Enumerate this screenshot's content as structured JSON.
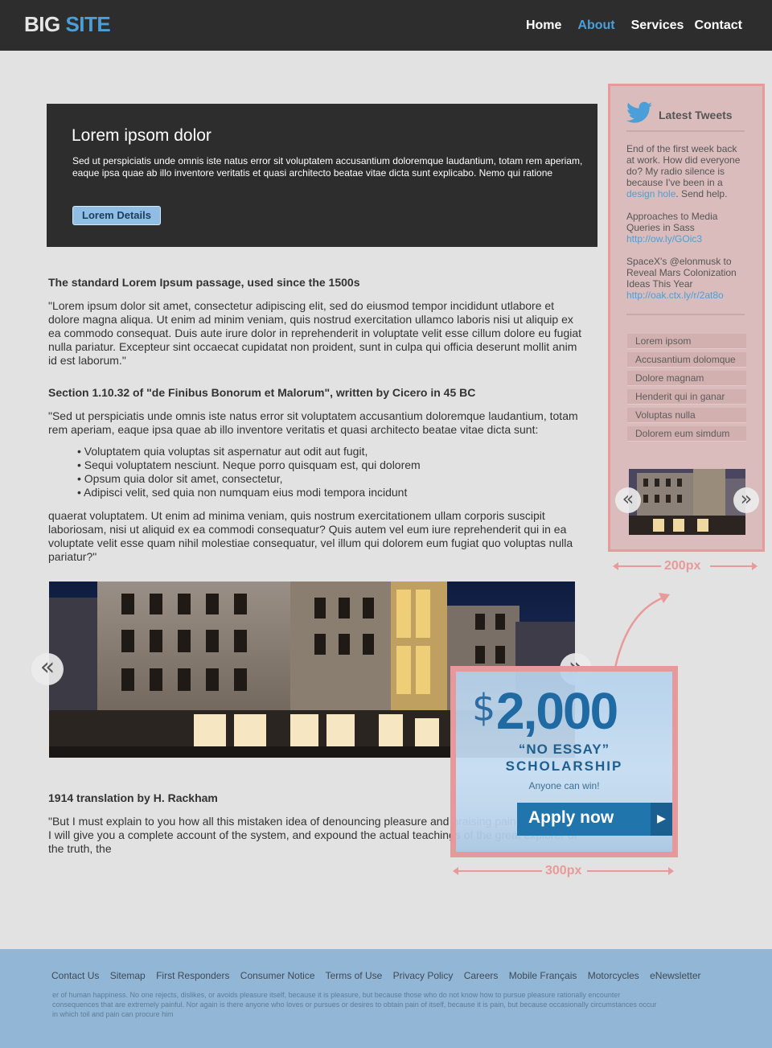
{
  "header": {
    "logo_big": "BIG",
    "logo_site": "SITE",
    "nav": [
      "Home",
      "About",
      "Services",
      "Contact"
    ],
    "active_nav": "About"
  },
  "hero": {
    "title": "Lorem ipsom dolor",
    "text": "Sed ut perspiciatis unde omnis iste natus error sit voluptatem accusantium doloremque laudantium, totam rem aperiam, eaque ipsa quae ab illo inventore veritatis et quasi architecto beatae vitae dicta sunt explicabo. Nemo qui ratione",
    "button": "Lorem Details"
  },
  "content": {
    "section1_title": "The standard Lorem Ipsum passage, used since the 1500s",
    "section1_text": "\"Lorem ipsum dolor sit amet, consectetur adipiscing elit, sed do eiusmod tempor incididunt utlabore et dolore magna aliqua. Ut enim ad minim veniam, quis nostrud exercitation ullamco laboris nisi ut aliquip ex ea commodo consequat. Duis aute irure dolor in reprehenderit in voluptate velit esse cillum dolore eu fugiat nulla pariatur. Excepteur sint occaecat cupidatat non proident, sunt in culpa qui officia deserunt mollit anim id est laborum.\"",
    "section2_title": "Section 1.10.32 of \"de Finibus Bonorum et Malorum\", written by Cicero in 45 BC",
    "section2_text": "\"Sed ut perspiciatis unde omnis iste natus error sit voluptatem accusantium doloremque laudantium, totam rem aperiam, eaque ipsa quae ab illo inventore veritatis et quasi architecto beatae vitae dicta sunt:",
    "bullets": [
      "Voluptatem quia voluptas sit aspernatur aut odit aut fugit,",
      "Sequi voluptatem nesciunt. Neque porro quisquam est, qui dolorem",
      "Opsum quia dolor sit amet, consectetur,",
      "Adipisci velit, sed quia non numquam eius modi tempora incidunt"
    ],
    "section2_after": "quaerat voluptatem. Ut enim ad minima veniam, quis nostrum exercitationem ullam corporis suscipit laboriosam, nisi ut aliquid ex ea commodi consequatur? Quis autem vel eum iure reprehenderit qui in ea voluptate velit esse quam nihil molestiae consequatur, vel illum qui dolorem eum fugiat quo voluptas nulla pariatur?\"",
    "section3_title": "1914 translation by H. Rackham",
    "section3_text": "\"But I must explain to you how all this mistaken idea of denouncing pleasure and praising pain was born and I will give you a complete account of the system, and expound the actual teachings of the great explorer of the truth, the"
  },
  "slider": {
    "prev_glyph": "«",
    "next_glyph": "»"
  },
  "sidebar": {
    "title": "Latest Tweets",
    "tweets": [
      {
        "text": "End of the first week back at work. How did everyone do? My radio silence is because I've been in a ",
        "link": "design hole",
        "after": ". Send help."
      },
      {
        "text": "Approaches to Media Queries in Sass",
        "link": "http://ow.ly/GOic3",
        "after": ""
      },
      {
        "text": "SpaceX's @elonmusk to Reveal Mars Colonization Ideas This Year",
        "link": "http://oak.ctx.ly/r/2at8o",
        "after": ""
      }
    ],
    "menu": [
      "Lorem ipsom",
      "Accusantium dolomque",
      "Dolore magnam",
      "Henderit qui in ganar",
      "Voluptas nulla",
      "Dolorem eum simdum"
    ],
    "width_label": "200px"
  },
  "ad": {
    "dollar": "$",
    "amount": "2,000",
    "line1": "“NO ESSAY”",
    "line2": "SCHOLARSHIP",
    "line3": "Anyone can win!",
    "button": "Apply now",
    "button_glyph": "▶",
    "width_label": "300px"
  },
  "footer": {
    "links": [
      "Contact Us",
      "Sitemap",
      "First Responders",
      "Consumer Notice",
      "Terms of Use",
      "Privacy Policy",
      "Careers",
      "Mobile Français",
      "Motorcycles",
      "eNewsletter"
    ],
    "text": "er of human happiness. No one rejects, dislikes, or avoids pleasure itself, because it is pleasure, but because those who do not know how to pursue pleasure rationally encounter consequences that are extremely painful. Nor again is there anyone who loves or pursues or desires to obtain pain of itself, because it is pain, but because occasionally circumstances occur in which toil and pain can procure him"
  },
  "colors": {
    "header_bg": "#2d2d2d",
    "accent": "#4a9fd8",
    "annotation": "#e89a9a",
    "footer_bg": "#92b6d5"
  }
}
